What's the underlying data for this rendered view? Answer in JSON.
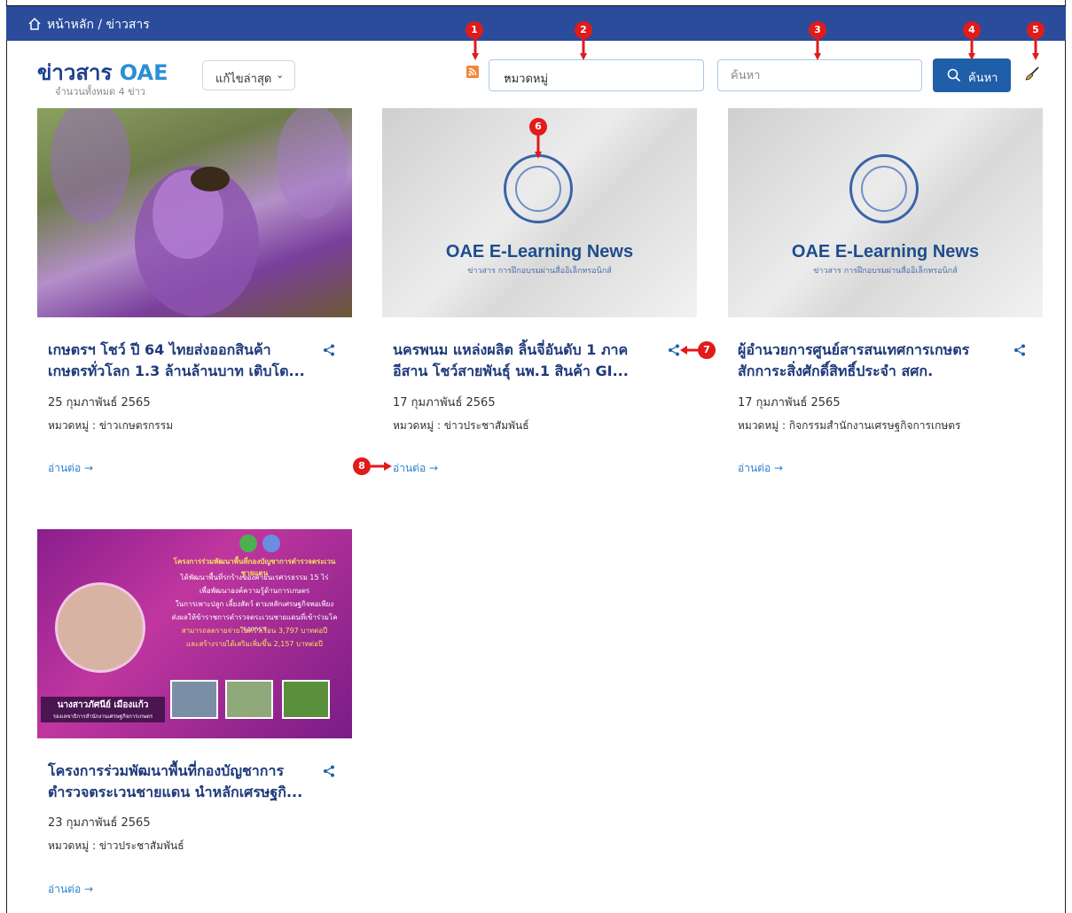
{
  "breadcrumb": {
    "text": "หน้าหลัก / ข่าวสาร"
  },
  "header": {
    "title_main": "ข่าวสาร",
    "title_brand": "OAE",
    "count_text": "จำนวนทั้งหมด 4 ข่าว",
    "sort_label": "แก้ไขล่าสุด",
    "category_select": "หมวดหมู่",
    "search_placeholder": "ค้นหา",
    "search_button": "ค้นหา"
  },
  "markers": [
    "1",
    "2",
    "3",
    "4",
    "5",
    "6",
    "7",
    "8"
  ],
  "cards": [
    {
      "title_line1": "เกษตรฯ โชว์ ปี 64 ไทยส่งออกสินค้า",
      "title_line2": "เกษตรทั่วโลก 1.3 ล้านล้านบาท เติบโต...",
      "date": "25 กุมภาพันธ์ 2565",
      "category": "หมวดหมู่ : ข่าวเกษตรกรรม",
      "read_more": "อ่านต่อ →"
    },
    {
      "title_line1": "นครพนม แหล่งผลิต ลิ้นจี่อันดับ 1 ภาค",
      "title_line2": "อีสาน โชว์สายพันธุ์ นพ.1 สินค้า GI...",
      "date": "17 กุมภาพันธ์ 2565",
      "category": "หมวดหมู่ : ข่าวประชาสัมพันธ์",
      "read_more": "อ่านต่อ →",
      "image_title": "OAE E-Learning News",
      "image_subtitle": "ข่าวสาร การฝึกอบรมผ่านสื่ออิเล็กทรอนิกส์"
    },
    {
      "title_line1": "ผู้อำนวยการศูนย์สารสนเทศการเกษตร",
      "title_line2": "สักการะสิ่งศักดิ์สิทธิ์ประจำ สศก.",
      "date": "17 กุมภาพันธ์ 2565",
      "category": "หมวดหมู่ : กิจกรรมสำนักงานเศรษฐกิจการเกษตร",
      "read_more": "อ่านต่อ →",
      "image_title": "OAE E-Learning News",
      "image_subtitle": "ข่าวสาร การฝึกอบรมผ่านสื่ออิเล็กทรอนิกส์"
    },
    {
      "title_line1": "โครงการร่วมพัฒนาพื้นที่กองบัญชาการ",
      "title_line2": "ตำรวจตระเวนชายแดน นำหลักเศรษฐกิ...",
      "date": "23 กุมภาพันธ์ 2565",
      "category": "หมวดหมู่ : ข่าวประชาสัมพันธ์",
      "read_more": "อ่านต่อ →",
      "poster_lines": [
        "โครงการร่วมพัฒนาพื้นที่กองบัญชาการตำรวจตระเวนชายแดน",
        "ได้พัฒนาพื้นที่รกร้างของค่ายนเรศวรธรรม 15 ไร่",
        "เพื่อพัฒนาองค์ความรู้ด้านการเกษตร",
        "ในการเพาะปลูก เลี้ยงสัตว์ ตามหลักเศรษฐกิจพอเพียง",
        "ส่งผลให้ข้าราชการตำรวจตระเวนชายแดนที่เข้าร่วมโครงการฯ",
        "สามารถลดรายจ่ายในครัวเรือน 3,797 บาทต่อปี",
        "และสร้างรายได้เสริมเพิ่มขึ้น 2,157 บาทต่อปี"
      ],
      "poster_name": "นางสาวภัศนีย์ เมืองแก้ว",
      "poster_role": "รองเลขาธิการสำนักงานเศรษฐกิจการเกษตร"
    }
  ],
  "colors": {
    "header_bg": "#2b4c9b",
    "title_blue": "#1e3a7a",
    "brand_blue": "#2a8fd6",
    "button_blue": "#1f5ea8",
    "marker_red": "#e11a1a",
    "link_blue": "#2a7fd0"
  }
}
